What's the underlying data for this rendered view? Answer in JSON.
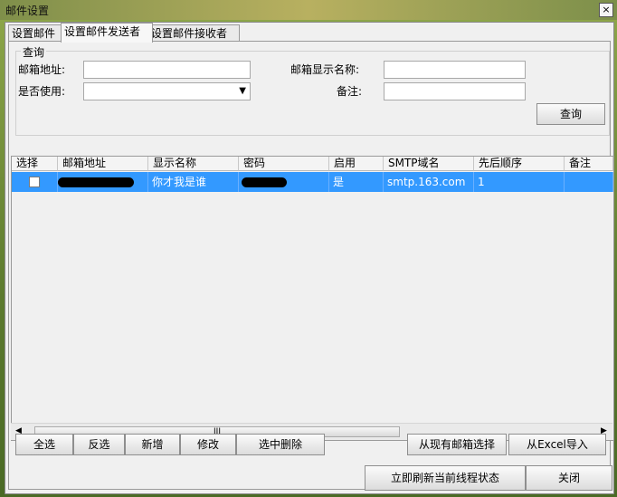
{
  "window": {
    "title": "邮件设置",
    "close_glyph": "×"
  },
  "tabs": [
    {
      "label": "设置邮件"
    },
    {
      "label": "设置邮件发送者"
    },
    {
      "label": "设置邮件接收者"
    }
  ],
  "query": {
    "group_label": "查询",
    "email_label": "邮箱地址:",
    "email_value": "",
    "display_name_label": "邮箱显示名称:",
    "display_name_value": "",
    "use_label": "是否使用:",
    "use_value": "",
    "remark_label": "备注:",
    "remark_value": "",
    "button_label": "查询"
  },
  "table": {
    "columns": [
      "选择",
      "邮箱地址",
      "显示名称",
      "密码",
      "启用",
      "SMTP域名",
      "先后顺序",
      "备注"
    ],
    "rows": [
      {
        "email": "",
        "display_name": "你才我是谁",
        "password": "",
        "enabled": "是",
        "smtp": "smtp.163.com",
        "order": "1",
        "remark": ""
      }
    ]
  },
  "scrollbar": {
    "left_arrow": "◀",
    "right_arrow": "▶",
    "thumb_grip": "III"
  },
  "buttons": {
    "select_all": "全选",
    "invert": "反选",
    "add": "新增",
    "edit": "修改",
    "delete_selected": "选中删除",
    "choose_existing": "从现有邮箱选择",
    "import_excel": "从Excel导入",
    "refresh_threads": "立即刷新当前线程状态",
    "close": "关闭"
  },
  "icons": {
    "close": "close-icon",
    "dropdown": "chevron-down-icon",
    "scroll_left": "arrow-left-icon",
    "scroll_right": "arrow-right-icon"
  }
}
